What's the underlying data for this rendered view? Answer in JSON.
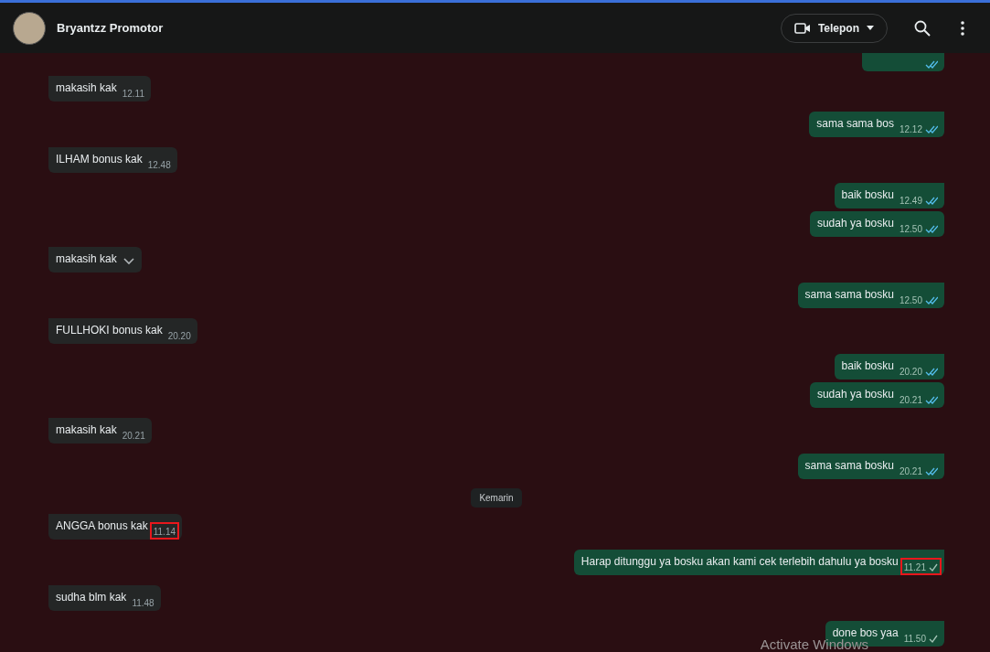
{
  "header": {
    "contact_name": "Bryantzz Promotor",
    "call_button": {
      "label": "Telepon"
    }
  },
  "messages": [
    {
      "kind": "message",
      "outgoing": true,
      "read": true,
      "tail": false
    },
    {
      "kind": "message",
      "outgoing": false,
      "text": "makasih kak",
      "time": "12.11",
      "tail": true,
      "highlighted": false,
      "hovered": false
    },
    {
      "kind": "message",
      "outgoing": true,
      "text": "sama sama bos",
      "time": "12.12",
      "read": true,
      "tail": true,
      "highlighted": false,
      "hovered": false
    },
    {
      "kind": "message",
      "outgoing": false,
      "text": "ILHAM bonus kak",
      "time": "12.48",
      "tail": true,
      "highlighted": false,
      "hovered": false
    },
    {
      "kind": "message",
      "outgoing": true,
      "text": "baik bosku",
      "time": "12.49",
      "read": true,
      "tail": true,
      "highlighted": false,
      "hovered": false
    },
    {
      "kind": "message",
      "outgoing": true,
      "text": "sudah ya bosku",
      "time": "12.50",
      "read": true,
      "tail": false,
      "highlighted": false,
      "hovered": false
    },
    {
      "kind": "message",
      "outgoing": false,
      "text": "makasih kak",
      "tail": true,
      "hovered": true
    },
    {
      "kind": "message",
      "outgoing": true,
      "text": "sama sama bosku",
      "time": "12.50",
      "read": true,
      "tail": true,
      "highlighted": false,
      "hovered": false
    },
    {
      "kind": "message",
      "outgoing": false,
      "text": "FULLHOKI bonus kak",
      "time": "20.20",
      "tail": true,
      "highlighted": false,
      "hovered": false
    },
    {
      "kind": "message",
      "outgoing": true,
      "text": "baik bosku",
      "time": "20.20",
      "read": true,
      "tail": true,
      "highlighted": false,
      "hovered": false
    },
    {
      "kind": "message",
      "outgoing": true,
      "text": "sudah ya bosku",
      "time": "20.21",
      "read": true,
      "tail": false,
      "highlighted": false,
      "hovered": false
    },
    {
      "kind": "message",
      "outgoing": false,
      "text": "makasih kak",
      "time": "20.21",
      "tail": true,
      "highlighted": false,
      "hovered": false
    },
    {
      "kind": "message",
      "outgoing": true,
      "text": "sama sama bosku",
      "time": "20.21",
      "read": true,
      "tail": true,
      "highlighted": false,
      "hovered": false
    },
    {
      "kind": "date",
      "text": "Kemarin"
    },
    {
      "kind": "message",
      "outgoing": false,
      "text": "ANGGA bonus kak",
      "time": "11.14",
      "tail": true,
      "highlighted": true,
      "hovered": false
    },
    {
      "kind": "message",
      "outgoing": true,
      "text": "Harap ditunggu ya bosku akan kami cek terlebih dahulu ya bosku",
      "time": "11.21",
      "read": false,
      "tail": true,
      "highlighted": true,
      "hovered": false
    },
    {
      "kind": "message",
      "outgoing": false,
      "text": "sudha blm kak",
      "time": "11.48",
      "tail": true,
      "highlighted": false,
      "hovered": false
    },
    {
      "kind": "message",
      "outgoing": true,
      "text": "done bos yaa",
      "time": "11.50",
      "read": false,
      "tail": true,
      "highlighted": false,
      "hovered": false
    }
  ],
  "os_overlay": {
    "text": "Activate Windows"
  }
}
